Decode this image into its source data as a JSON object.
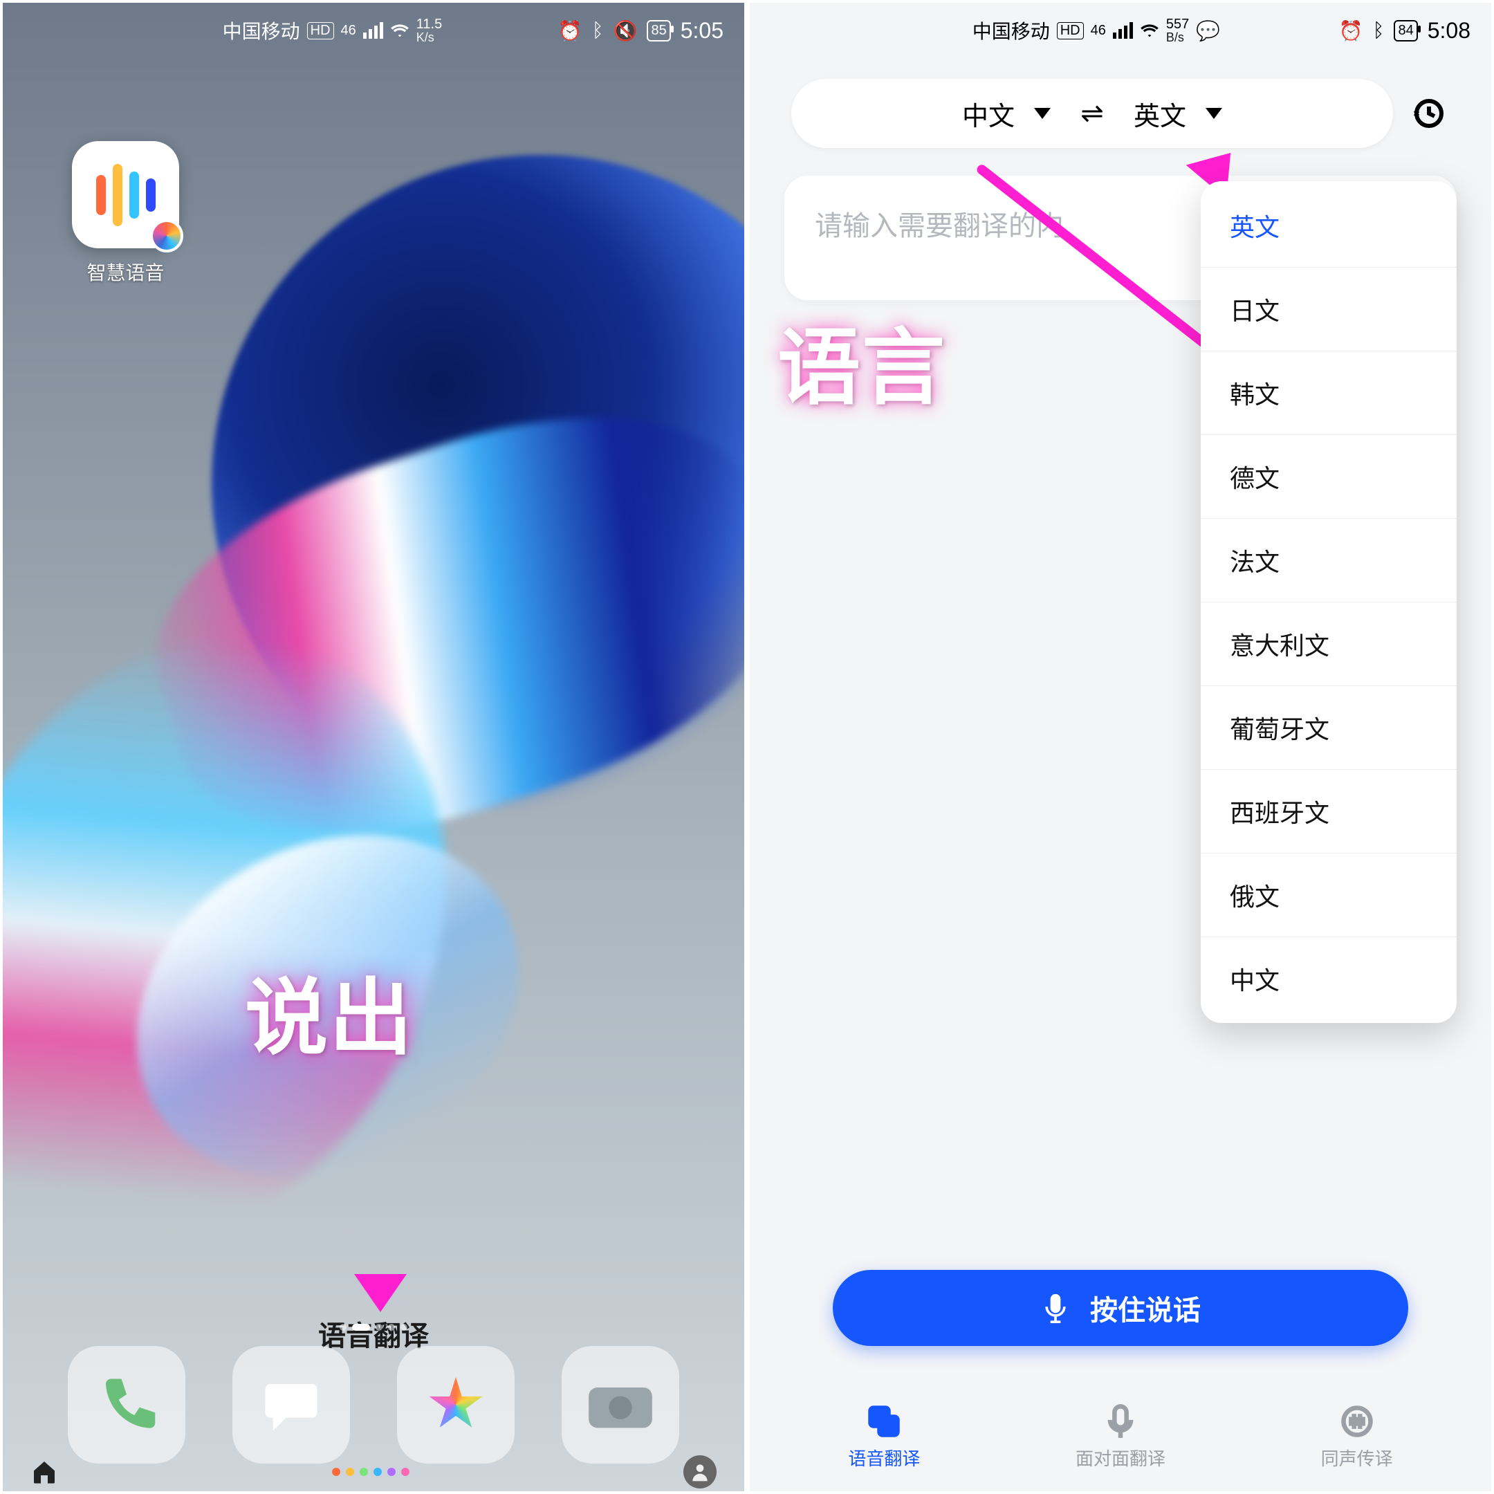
{
  "left": {
    "statusbar": {
      "carrier": "中国移动",
      "hd": "HD",
      "net": "46",
      "speed_value": "11.5",
      "speed_unit": "K/s",
      "battery": "85",
      "time": "5:05"
    },
    "app_icon_label": "智慧语音",
    "annotation": "说出",
    "voice_translate_label": "语音翻译"
  },
  "right": {
    "statusbar": {
      "carrier": "中国移动",
      "hd": "HD",
      "net": "46",
      "speed_value": "557",
      "speed_unit": "B/s",
      "battery": "84",
      "time": "5:08"
    },
    "lang_from": "中文",
    "lang_to": "英文",
    "input_placeholder": "请输入需要翻译的内",
    "annotation": "语言",
    "menu": {
      "selected_index": 0,
      "items": [
        "英文",
        "日文",
        "韩文",
        "德文",
        "法文",
        "意大利文",
        "葡萄牙文",
        "西班牙文",
        "俄文",
        "中文"
      ]
    },
    "talk_button": "按住说话",
    "tabs": [
      "语音翻译",
      "面对面翻译",
      "同声传译"
    ],
    "active_tab_index": 0
  }
}
